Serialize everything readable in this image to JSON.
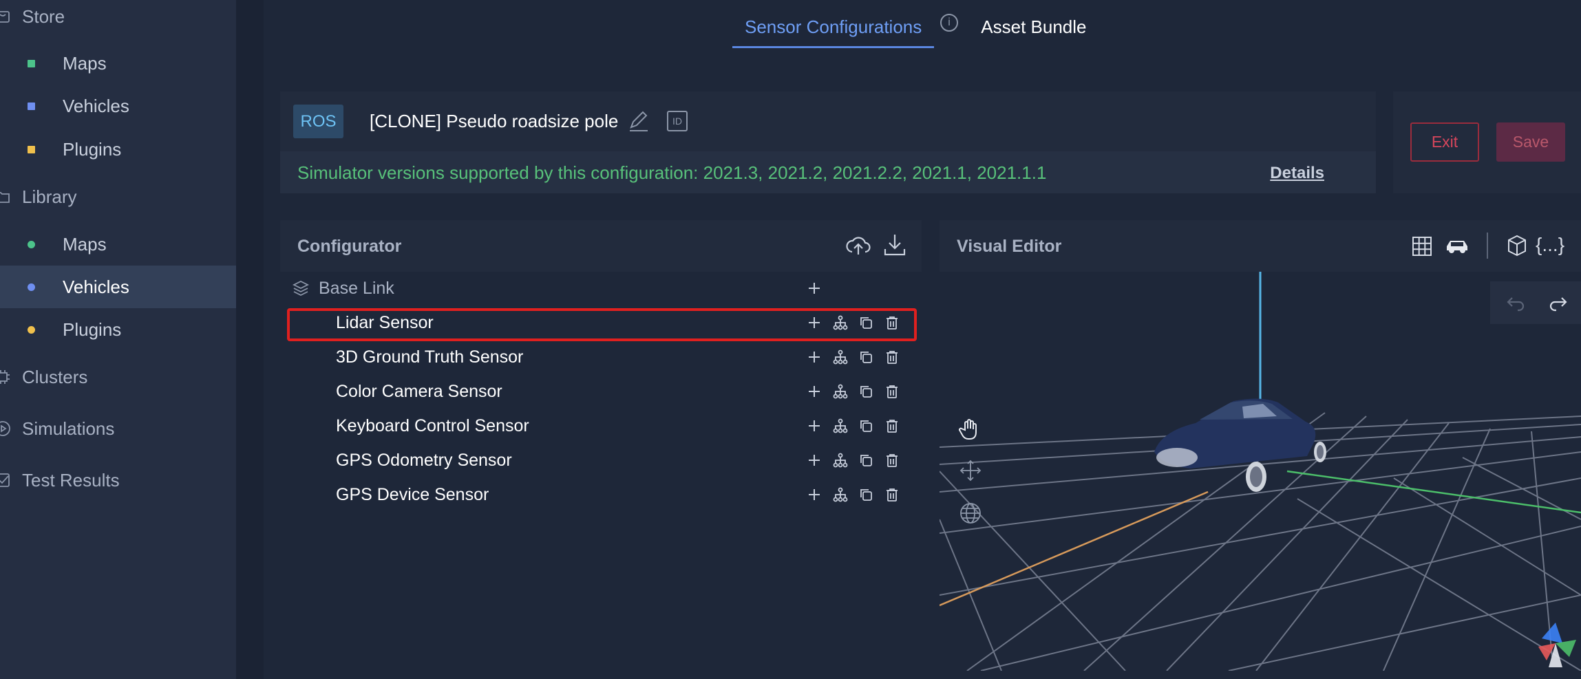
{
  "sidebar": {
    "store": {
      "label": "Store"
    },
    "store_items": [
      {
        "label": "Maps",
        "color": "#4cc38a"
      },
      {
        "label": "Vehicles",
        "color": "#6f8ff0"
      },
      {
        "label": "Plugins",
        "color": "#f0c04c"
      }
    ],
    "library": {
      "label": "Library"
    },
    "library_items": [
      {
        "label": "Maps",
        "color": "#4cc38a"
      },
      {
        "label": "Vehicles",
        "color": "#6f8ff0"
      },
      {
        "label": "Plugins",
        "color": "#f0c04c"
      }
    ],
    "clusters": {
      "label": "Clusters"
    },
    "simulations": {
      "label": "Simulations"
    },
    "test_results": {
      "label": "Test Results"
    }
  },
  "tabs": {
    "sensor_configurations": "Sensor Configurations",
    "asset_bundle": "Asset Bundle"
  },
  "header": {
    "badge": "ROS",
    "config_name": "[CLONE] Pseudo roadsize pole",
    "id_label": "ID",
    "versions_text": "Simulator versions supported by this configuration: 2021.3, 2021.2, 2021.2.2, 2021.1, 2021.1.1",
    "details_link": "Details"
  },
  "actions": {
    "exit": "Exit",
    "save": "Save"
  },
  "configurator": {
    "title": "Configurator",
    "base_link": "Base Link",
    "sensors": [
      "Lidar Sensor",
      "3D Ground Truth Sensor",
      "Color Camera Sensor",
      "Keyboard Control Sensor",
      "GPS Odometry Sensor",
      "GPS Device Sensor"
    ]
  },
  "visual_editor": {
    "title": "Visual Editor",
    "json_icon_text": "{...}"
  }
}
